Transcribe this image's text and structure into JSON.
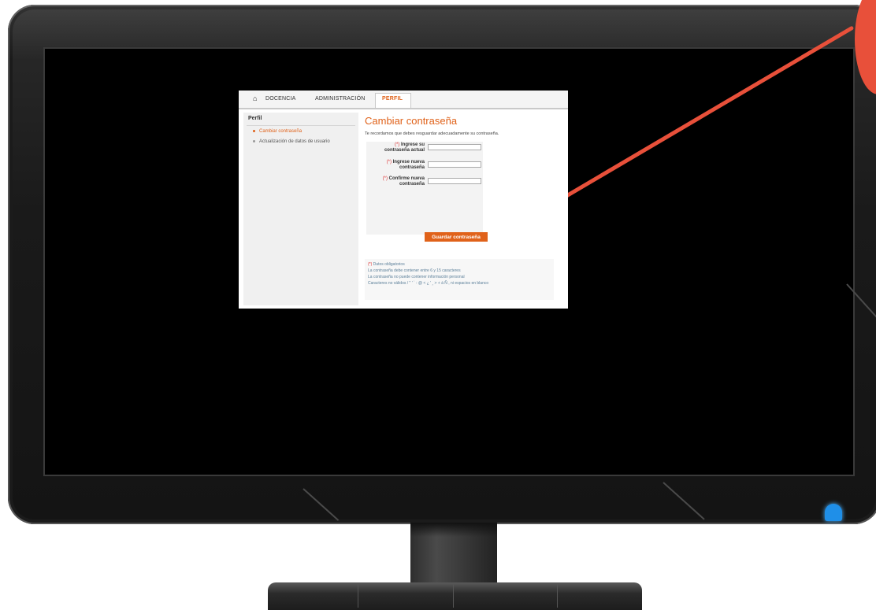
{
  "nav": {
    "items": [
      {
        "label": "DOCENCIA"
      },
      {
        "label": "ADMINISTRACIÓN"
      },
      {
        "label": "PERFIL"
      }
    ]
  },
  "sidebar": {
    "title": "Perfil",
    "items": [
      {
        "label": "Cambiar contraseña",
        "active": true
      },
      {
        "label": "Actualización de datos de usuario",
        "active": false
      }
    ]
  },
  "main": {
    "title": "Cambiar contraseña",
    "intro": "Te recordamos que debes resguardar adecuadamente su contraseña.",
    "fields": [
      {
        "req": "(*)",
        "label_line1": "Ingrese su",
        "label_line2": "contraseña actual",
        "value": ""
      },
      {
        "req": "(*)",
        "label_line1": "Ingrese nueva",
        "label_line2": "contraseña",
        "value": ""
      },
      {
        "req": "(*)",
        "label_line1": "Confirme nueva",
        "label_line2": "contraseña",
        "value": ""
      }
    ],
    "save_label": "Guardar contraseña"
  },
  "notes": {
    "required_marker": "(*)",
    "required_text": "Datos obligatorios",
    "line1": "La contraseña debe contener entre 6 y 15 caracteres",
    "line2": "La contraseña no puede contener información personal",
    "line3": "Caracteres no válidos / \" ' ` : @ < ¿ ' ¸ > + á Ñ , ni espacios en blanco"
  },
  "colors": {
    "accent": "#e0621a",
    "pointer": "#e8503a",
    "power_led": "#1f8fe8"
  },
  "icons": {
    "home": "home-icon",
    "power": "power-led-icon"
  }
}
